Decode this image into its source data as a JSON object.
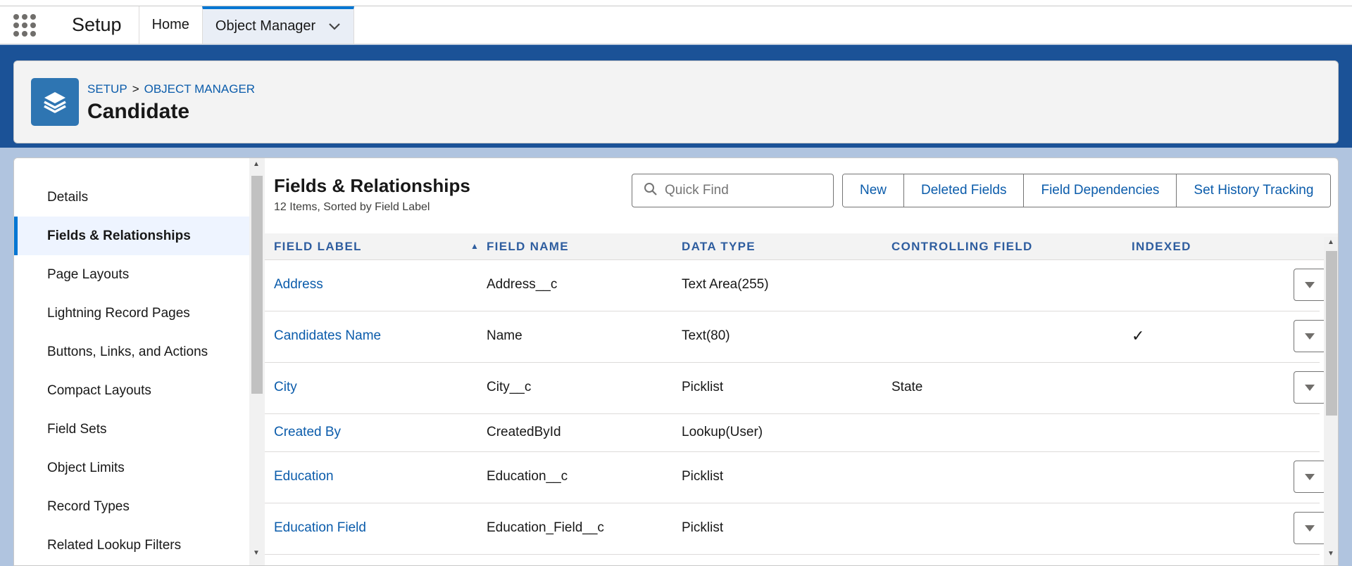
{
  "topnav": {
    "app_launcher_icon": "app-launcher-grid-icon",
    "app_name": "Setup",
    "tabs": [
      {
        "label": "Home"
      },
      {
        "label": "Object Manager",
        "active": true,
        "icon": "chevron-down-icon"
      }
    ]
  },
  "header": {
    "icon": "layers-icon",
    "breadcrumb": [
      "SETUP",
      ">",
      "OBJECT MANAGER"
    ],
    "title": "Candidate"
  },
  "sidebar": {
    "items": [
      {
        "label": "Details"
      },
      {
        "label": "Fields & Relationships",
        "active": true
      },
      {
        "label": "Page Layouts"
      },
      {
        "label": "Lightning Record Pages"
      },
      {
        "label": "Buttons, Links, and Actions"
      },
      {
        "label": "Compact Layouts"
      },
      {
        "label": "Field Sets"
      },
      {
        "label": "Object Limits"
      },
      {
        "label": "Record Types"
      },
      {
        "label": "Related Lookup Filters"
      }
    ]
  },
  "list": {
    "title": "Fields & Relationships",
    "subtitle": "12 Items, Sorted by Field Label",
    "quickfind_placeholder": "Quick Find",
    "buttons": [
      "New",
      "Deleted Fields",
      "Field Dependencies",
      "Set History Tracking"
    ],
    "columns": [
      "FIELD LABEL",
      "FIELD NAME",
      "DATA TYPE",
      "CONTROLLING FIELD",
      "INDEXED"
    ],
    "sort_indicator": "▲",
    "rows": [
      {
        "label": "Address",
        "name": "Address__c",
        "type": "Text Area(255)",
        "controlling": "",
        "indexed": "",
        "has_action": true
      },
      {
        "label": "Candidates Name",
        "name": "Name",
        "type": "Text(80)",
        "controlling": "",
        "indexed": "✓",
        "has_action": true
      },
      {
        "label": "City",
        "name": "City__c",
        "type": "Picklist",
        "controlling": "State",
        "indexed": "",
        "has_action": true
      },
      {
        "label": "Created By",
        "name": "CreatedById",
        "type": "Lookup(User)",
        "controlling": "",
        "indexed": "",
        "has_action": false
      },
      {
        "label": "Education",
        "name": "Education__c",
        "type": "Picklist",
        "controlling": "",
        "indexed": "",
        "has_action": true
      },
      {
        "label": "Education Field",
        "name": "Education_Field__c",
        "type": "Picklist",
        "controlling": "",
        "indexed": "",
        "has_action": true
      }
    ]
  },
  "colors": {
    "brand_blue": "#1b5297",
    "link": "#0b5cab",
    "active_tab_border": "#0176d3",
    "header_text": "#2e5d9f"
  }
}
